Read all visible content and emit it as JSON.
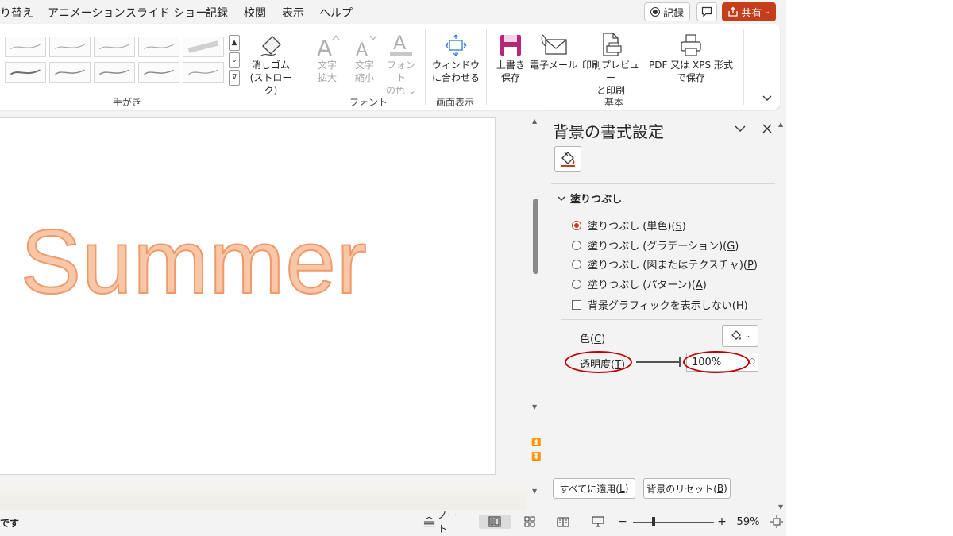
{
  "menu": {
    "items": [
      "り替え",
      "アニメーション",
      "スライド ショー",
      "記録",
      "校閲",
      "表示",
      "ヘルプ"
    ],
    "record_label": "記録",
    "share_label": "共有"
  },
  "ribbon": {
    "handwriting": {
      "group_label": "手がき",
      "eraser_label_1": "消しゴム",
      "eraser_label_2": "(ストローク)"
    },
    "font": {
      "group_label": "フォント",
      "increase_1": "文字",
      "increase_2": "拡大",
      "decrease_1": "文字",
      "decrease_2": "縮小",
      "color_1": "フォント",
      "color_2": "の色"
    },
    "display": {
      "group_label": "画面表示",
      "fit_1": "ウィンドウ",
      "fit_2": "に合わせる"
    },
    "basic": {
      "group_label": "基本",
      "save_1": "上書き",
      "save_2": "保存",
      "email": "電子メール",
      "print_1": "印刷プレビュー",
      "print_2": "と印刷",
      "pdf_1": "PDF 又は XPS 形式",
      "pdf_2": "で保存"
    }
  },
  "slide": {
    "text": "Summer",
    "text_fill": "#f7c7a8",
    "text_outline": "#ef9a6a"
  },
  "pane": {
    "title": "背景の書式設定",
    "section": "塗りつぶし",
    "options": [
      {
        "label": "塗りつぶし (単色)(",
        "key": "S",
        "end": ")",
        "selected": true
      },
      {
        "label": "塗りつぶし (グラデーション)(",
        "key": "G",
        "end": ")",
        "selected": false
      },
      {
        "label": "塗りつぶし (図またはテクスチャ)(",
        "key": "P",
        "end": ")",
        "selected": false
      },
      {
        "label": "塗りつぶし (パターン)(",
        "key": "A",
        "end": ")",
        "selected": false
      }
    ],
    "hide_graphics": {
      "label": "背景グラフィックを表示しない(",
      "key": "H",
      "end": ")",
      "checked": false
    },
    "color": {
      "label": "色(",
      "key": "C",
      "end": ")"
    },
    "transparency": {
      "label": "透明度(",
      "key": "T",
      "end": ")",
      "value": "100%",
      "fraction": 1.0
    },
    "apply_all": {
      "label": "すべてに適用(",
      "key": "L",
      "end": ")"
    },
    "reset": {
      "label": "背景のリセット(",
      "key": "B",
      "end": ")"
    }
  },
  "status": {
    "left_text": "です",
    "notes_label": "ノート",
    "zoom": "59%",
    "zoom_fraction": 0.59
  },
  "colors": {
    "accent": "#c43e1c",
    "annotation": "#c00000"
  }
}
